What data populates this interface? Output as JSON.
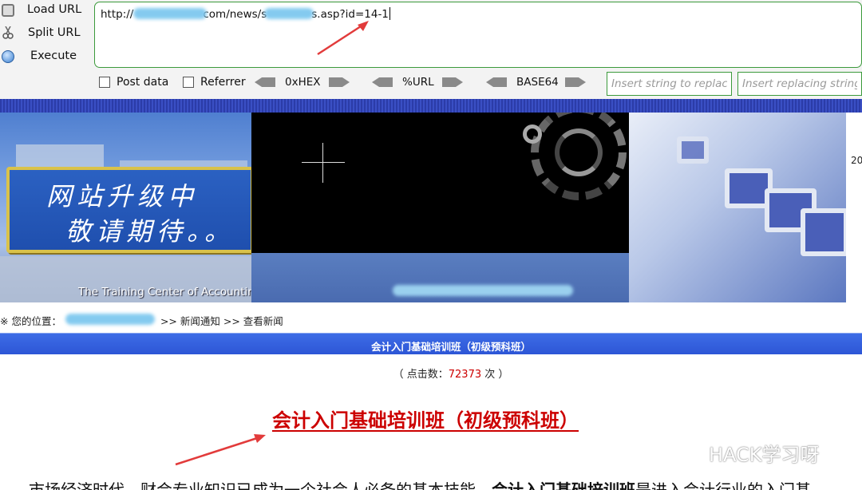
{
  "hackbar": {
    "load_url": "Load URL",
    "split_url": "Split URL",
    "execute": "Execute",
    "url_prefix": "http://",
    "url_mid": "com/news/s",
    "url_suffix": "s.asp?id=14-1",
    "post_data": "Post data",
    "referrer": "Referrer",
    "hex": "0xHEX",
    "url_enc": "%URL",
    "base64": "BASE64",
    "replace_placeholder": "Insert string to replace",
    "replacing_placeholder": "Insert replacing string"
  },
  "banner": {
    "sign_line1": "网站升级中",
    "sign_line2": "敬请期待。。",
    "training_center": "The Training Center of Accounting",
    "date_fragment": "20"
  },
  "breadcrumb": {
    "prefix": "※ 您的位置：",
    "trail": ">> 新闻通知 >> 查看新闻"
  },
  "article": {
    "bar_title": "会计入门基础培训班（初级预科班）",
    "hits_prefix": "（ 点击数：",
    "hits_count": "72373",
    "hits_suffix": " 次 ）",
    "headline": "会计入门基础培训班（初级预科班）",
    "body_start": "市场经济时代，财会专业知识已成为一个社会人必备的基本技能，",
    "body_bold": "会计入门基础培训班",
    "body_end": "是进入会计行业的入门基"
  },
  "watermark": "HACK学习呀",
  "colors": {
    "accent_green": "#3b9a3b",
    "title_blue": "#2d56d6",
    "headline_red": "#cc0000",
    "annotation_red": "#e23b3b"
  }
}
